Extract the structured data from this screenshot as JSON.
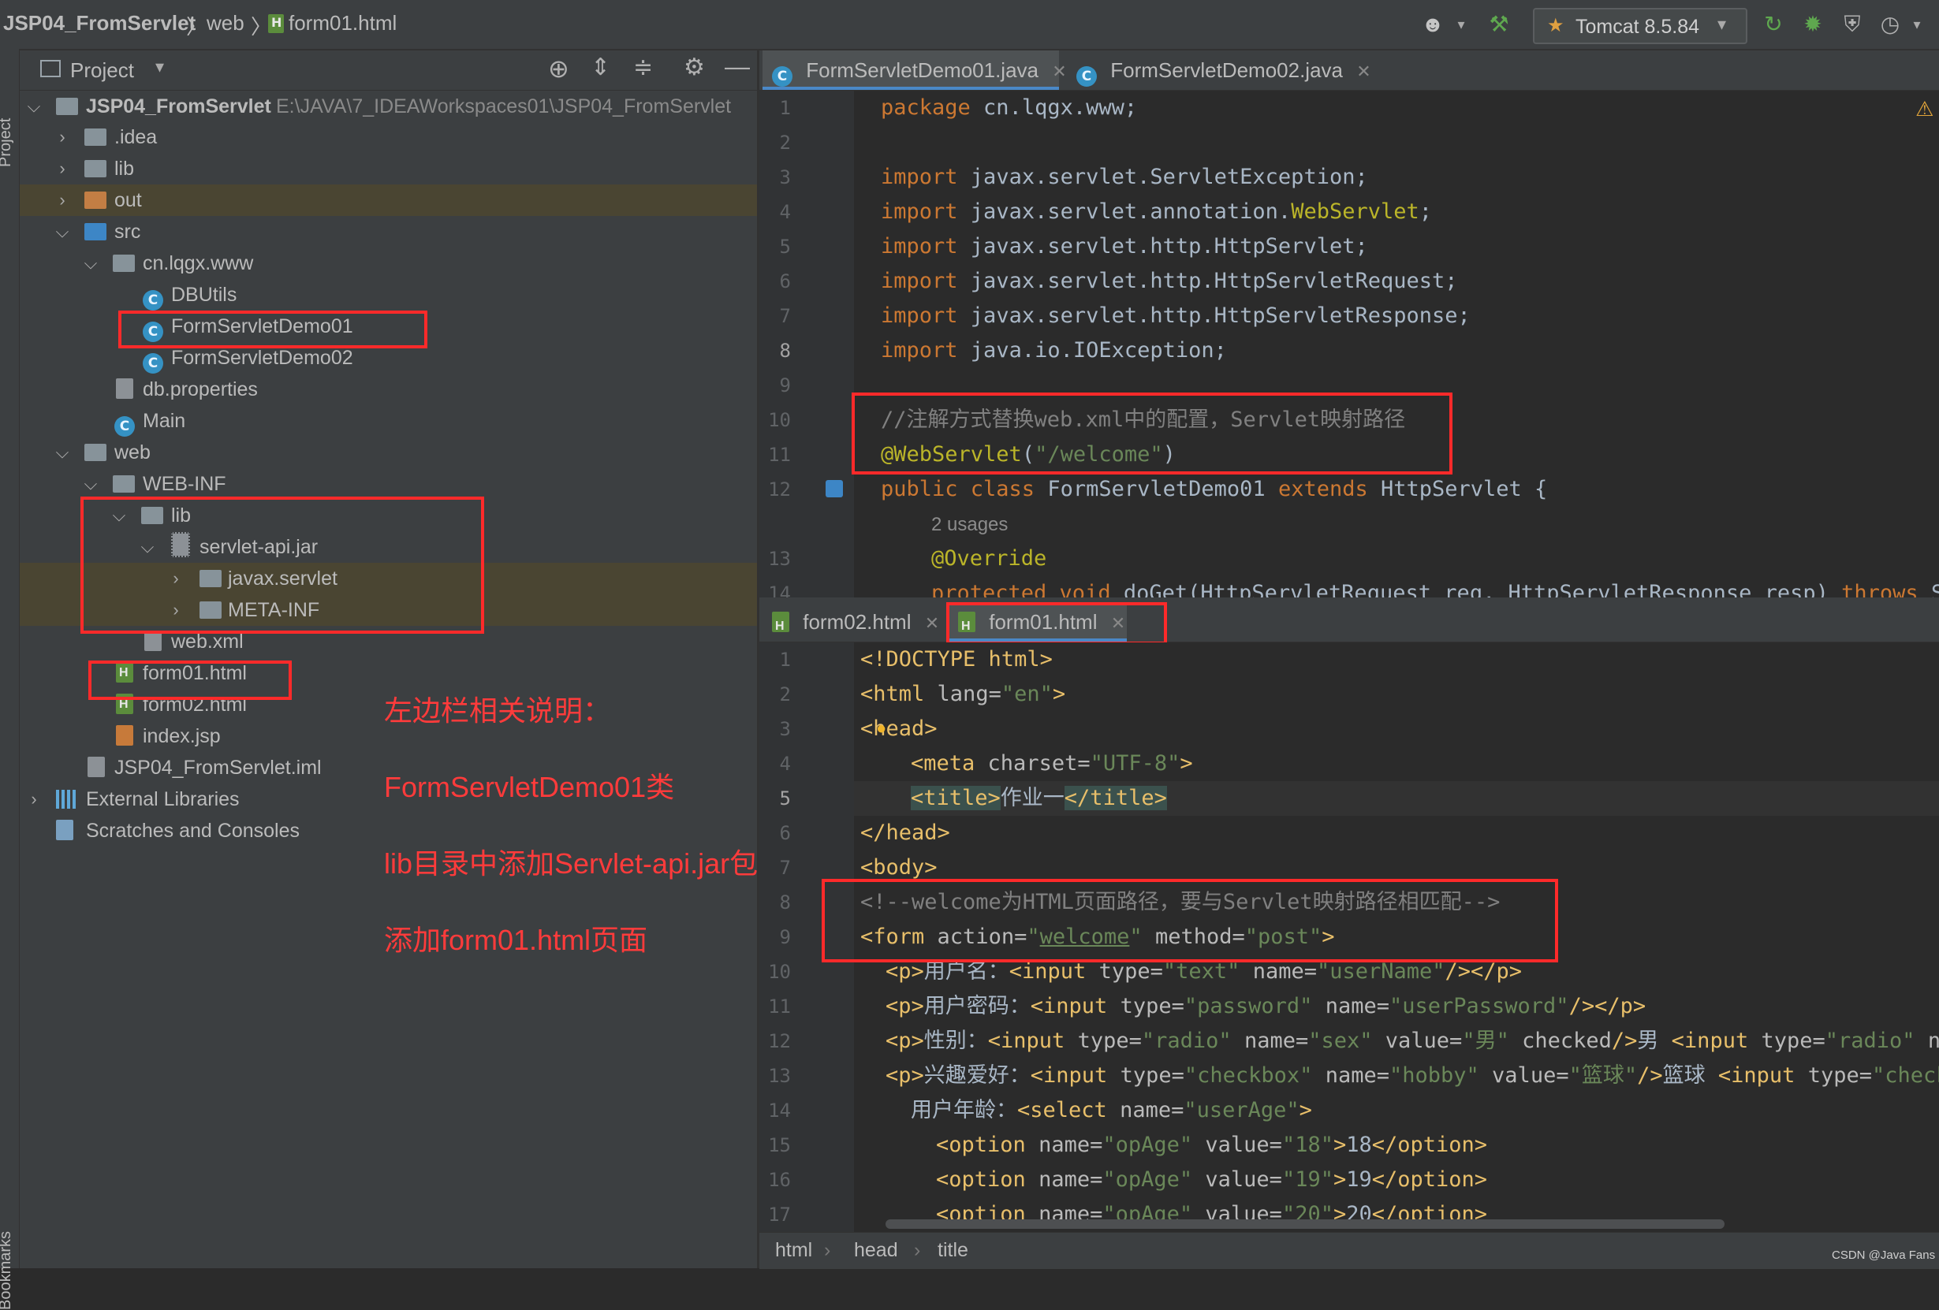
{
  "breadcrumb": {
    "project": "JSP04_FromServlet",
    "folder": "web",
    "file": "form01.html"
  },
  "toolbar": {
    "run_config": "Tomcat 8.5.84",
    "user_icon": "user-icon",
    "hammer_icon": "hammer-icon"
  },
  "side_labels": {
    "project": "Project",
    "bookmarks": "Bookmarks"
  },
  "project_panel": {
    "title": "Project",
    "root_name": "JSP04_FromServlet",
    "root_path": "E:\\JAVA\\7_IDEAWorkspaces01\\JSP04_FromServlet",
    "items": {
      "idea": ".idea",
      "lib": "lib",
      "out": "out",
      "src": "src",
      "pkg": "cn.lqgx.www",
      "dbutils": "DBUtils",
      "demo01": "FormServletDemo01",
      "demo02": "FormServletDemo02",
      "dbprops": "db.properties",
      "main": "Main",
      "web": "web",
      "webinf": "WEB-INF",
      "weblib": "lib",
      "jar": "servlet-api.jar",
      "javax": "javax.servlet",
      "metainf": "META-INF",
      "webxml": "web.xml",
      "form01": "form01.html",
      "form02": "form02.html",
      "indexjsp": "index.jsp",
      "iml": "JSP04_FromServlet.iml",
      "extlibs": "External Libraries",
      "scratches": "Scratches and Consoles"
    }
  },
  "notes": {
    "line1": "左边栏相关说明：",
    "line2": "FormServletDemo01类",
    "line3": "lib目录中添加Servlet-api.jar包",
    "line4": "添加form01.html页面"
  },
  "top_editor": {
    "tabs": [
      "FormServletDemo01.java",
      "FormServletDemo02.java"
    ],
    "usages_hint": "2 usages"
  },
  "bottom_editor": {
    "tabs": [
      "form02.html",
      "form01.html"
    ]
  },
  "status": {
    "crumb1": "html",
    "crumb2": "head",
    "crumb3": "title"
  },
  "watermark": "CSDN @Java Fans"
}
